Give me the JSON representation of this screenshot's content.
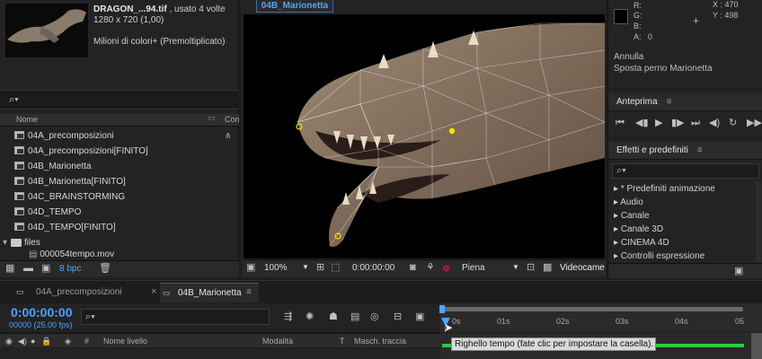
{
  "project_panel": {
    "file_name": "DRAGON_...94.tif",
    "file_usage": ", usato 4 volte",
    "dimensions": "1280 x 720 (1,00)",
    "color_info": "Milioni di colori+ (Premoltiplicato)",
    "search_placeholder": "⌕▾",
    "column_name": "Nome",
    "column_comment": "Con",
    "items": [
      {
        "label": "04A_precomposizioni",
        "type": "comp"
      },
      {
        "label": "04A_precomposizioni[FINITO]",
        "type": "comp"
      },
      {
        "label": "04B_Marionetta",
        "type": "comp"
      },
      {
        "label": "04B_Marionetta[FINITO]",
        "type": "comp"
      },
      {
        "label": "04C_BRAINSTORMING",
        "type": "comp"
      },
      {
        "label": "04D_TEMPO",
        "type": "comp"
      },
      {
        "label": "04D_TEMPO[FINITO]",
        "type": "comp"
      },
      {
        "label": "files",
        "type": "folder"
      },
      {
        "label": "000054tempo.mov",
        "type": "footage"
      }
    ],
    "bit_depth": "8 bpc"
  },
  "viewer": {
    "tab_label": "04B_Marionetta",
    "zoom": "100%",
    "timecode": "0:00:00:00",
    "resolution": "Piena",
    "camera": "Videocame"
  },
  "info_panel": {
    "r_label": "R:",
    "g_label": "G:",
    "b_label": "B:",
    "a_label": "A:",
    "a_value": "0",
    "x_label": "X : 470",
    "y_label": "Y : 498",
    "undo": "Annulla",
    "action": "Sposta perno Marionetta"
  },
  "preview_panel": {
    "title": "Anteprima"
  },
  "effects_panel": {
    "title": "Effetti e predefiniti",
    "items": [
      "* Predefiniti animazione",
      "Audio",
      "Canale",
      "Canale 3D",
      "CINEMA 4D",
      "Controlli espressione"
    ]
  },
  "timeline": {
    "tabs": [
      "04A_precomposizioni",
      "04B_Marionetta"
    ],
    "timecode": "0:00:00:00",
    "fps": "00000 (25.00 fps)",
    "ruler_marks": [
      "0s",
      "01s",
      "02s",
      "03s",
      "04s",
      "05"
    ],
    "columns": {
      "layer_name": "Nome livello",
      "mode": "Modalità",
      "t": "T",
      "track_matte": "Masch. traccia"
    },
    "tooltip": "Righello tempo (fate clic per impostare la casella)."
  },
  "colors": {
    "accent": "#4fa3ff",
    "timecode": "#4fa3ff",
    "panel": "#232323"
  }
}
